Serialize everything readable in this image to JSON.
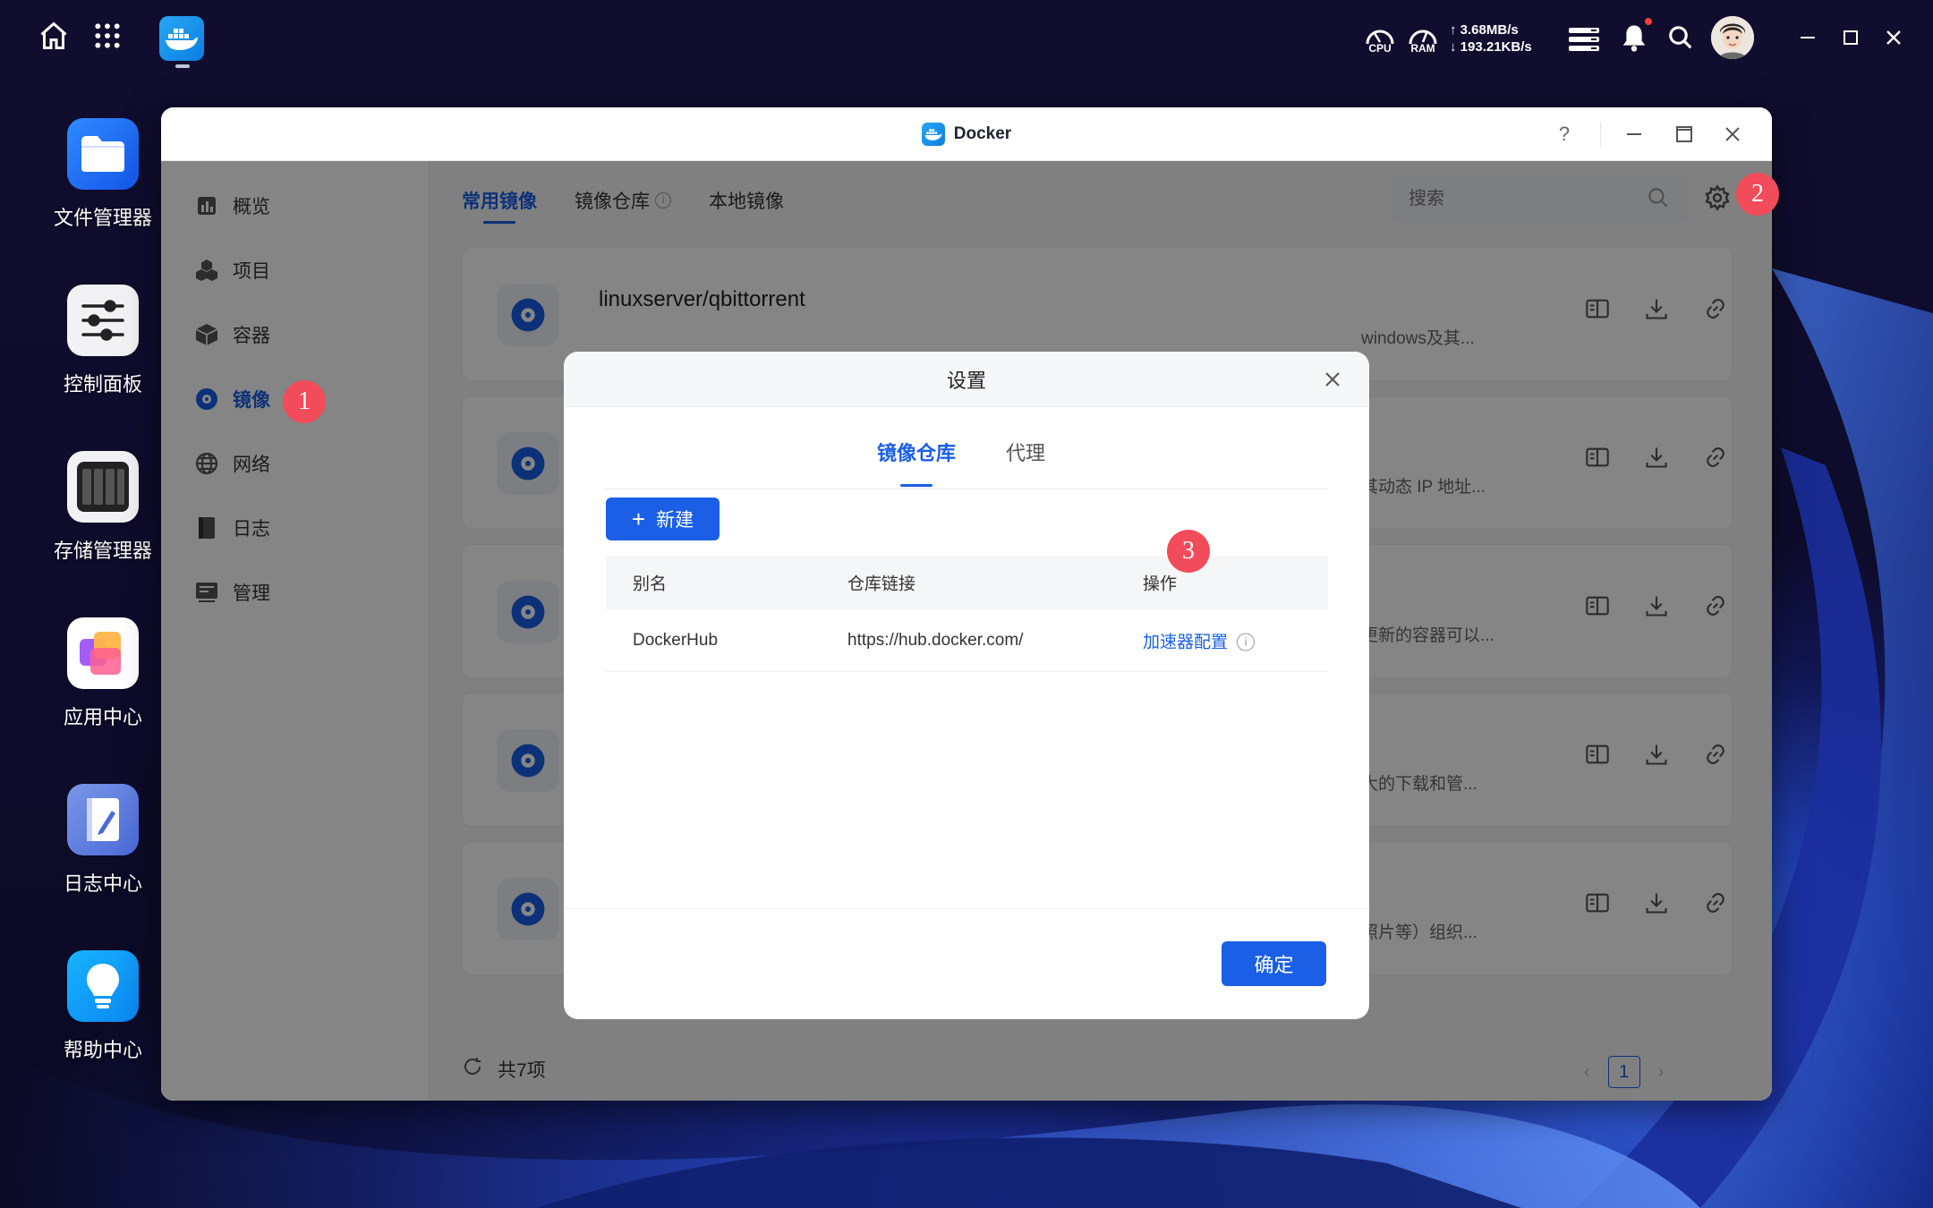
{
  "topbar": {
    "cpu_label": "CPU",
    "ram_label": "RAM",
    "upload_speed": "↑ 3.68MB/s",
    "download_speed": "↓ 193.21KB/s"
  },
  "desktop": {
    "items": [
      {
        "label": "文件管理器",
        "icon": "folder-icon"
      },
      {
        "label": "控制面板",
        "icon": "sliders-icon"
      },
      {
        "label": "存储管理器",
        "icon": "disk-bays-icon"
      },
      {
        "label": "应用中心",
        "icon": "app-store-icon"
      },
      {
        "label": "日志中心",
        "icon": "log-book-icon"
      },
      {
        "label": "帮助中心",
        "icon": "lightbulb-icon"
      }
    ]
  },
  "window": {
    "title": "Docker",
    "help": "?"
  },
  "sidebar": {
    "items": [
      {
        "label": "概览",
        "icon": "chart-icon"
      },
      {
        "label": "项目",
        "icon": "cubes-icon"
      },
      {
        "label": "容器",
        "icon": "container-icon"
      },
      {
        "label": "镜像",
        "icon": "image-disc-icon",
        "active": true
      },
      {
        "label": "网络",
        "icon": "globe-icon"
      },
      {
        "label": "日志",
        "icon": "book-icon"
      },
      {
        "label": "管理",
        "icon": "manage-icon"
      }
    ]
  },
  "badges": {
    "one": "1",
    "two": "2",
    "three": "3"
  },
  "main": {
    "tabs": [
      {
        "label": "常用镜像",
        "active": true
      },
      {
        "label": "镜像仓库"
      },
      {
        "label": "本地镜像"
      }
    ],
    "search_placeholder": "搜索",
    "cards": [
      {
        "name": "linuxserver/qbittorrent",
        "desc": "windows及其..."
      },
      {
        "name": "",
        "desc": "其动态 IP 地址..."
      },
      {
        "name": "",
        "desc": "更新的容器可以..."
      },
      {
        "name": "",
        "desc": "大的下载和管..."
      },
      {
        "name": "",
        "desc": "照片等）组织..."
      }
    ],
    "footer_total": "共7项",
    "page": "1"
  },
  "modal": {
    "title": "设置",
    "tabs": [
      {
        "label": "镜像仓库",
        "active": true
      },
      {
        "label": "代理"
      }
    ],
    "new_button": "新建",
    "table": {
      "headers": [
        "别名",
        "仓库链接",
        "操作"
      ],
      "rows": [
        {
          "alias": "DockerHub",
          "url": "https://hub.docker.com/",
          "action": "加速器配置"
        }
      ]
    },
    "ok_button": "确定"
  },
  "colors": {
    "accent": "#1a5fe6",
    "badge": "#f24b5a"
  }
}
